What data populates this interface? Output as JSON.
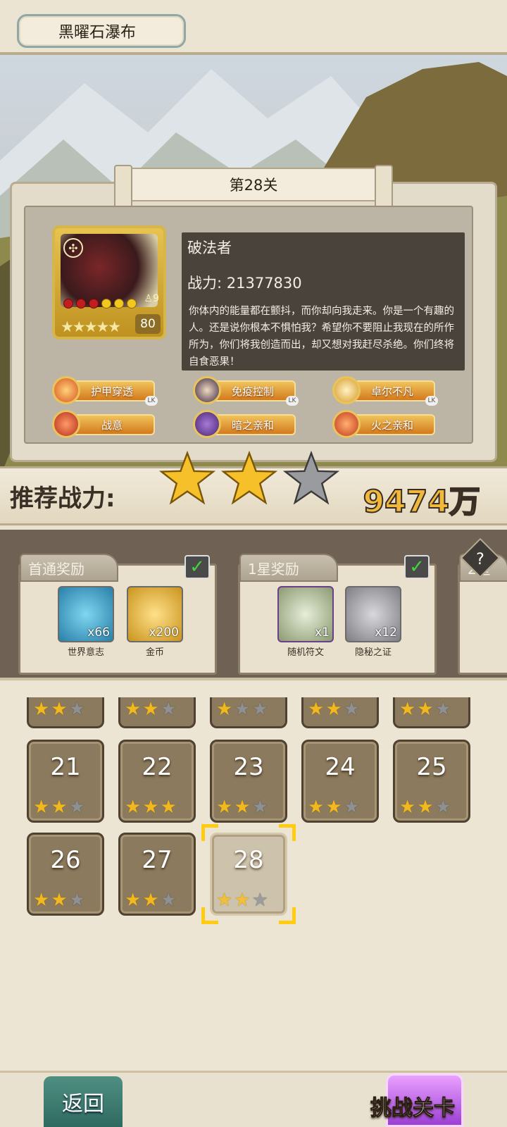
{
  "header": {
    "map_title": "黑曜石瀑布"
  },
  "stage": {
    "banner": "第28关",
    "boss": {
      "name": "破法者",
      "power_label": "战力: 21377830",
      "level": "80",
      "class_count": "9",
      "description": "你体内的能量都在颤抖，而你却向我走来。你是一个有趣的人。还是说你根本不惧怕我？希望你不要阻止我现在的所作所为，你们将我创造而出，却又想对我赶尽杀绝。你们终将自食恶果！"
    },
    "skills": [
      {
        "label": "护甲穿透",
        "icon": "armor-pierce-icon",
        "color": "#d9531f"
      },
      {
        "label": "免疫控制",
        "icon": "control-immune-icon",
        "color": "#3b2a44"
      },
      {
        "label": "卓尔不凡",
        "icon": "excellence-icon",
        "color": "#d79a2b"
      },
      {
        "label": "战意",
        "icon": "battle-will-icon",
        "color": "#b52c1c"
      },
      {
        "label": "暗之亲和",
        "icon": "dark-affinity-icon",
        "color": "#4a2470"
      },
      {
        "label": "火之亲和",
        "icon": "fire-affinity-icon",
        "color": "#c2371a"
      }
    ],
    "earned_stars": 2,
    "max_stars": 3
  },
  "recommend": {
    "label": "推荐战力:",
    "value": "9474万"
  },
  "rewards": [
    {
      "title": "首通奖励",
      "claimed": true,
      "items": [
        {
          "name": "世界意志",
          "count": "x66",
          "icon": "world-will-icon",
          "color": "#2a7fa8"
        },
        {
          "name": "金币",
          "count": "x200",
          "icon": "gold-coin-icon",
          "color": "#c9941d"
        }
      ]
    },
    {
      "title": "1星奖励",
      "claimed": true,
      "items": [
        {
          "name": "随机符文",
          "count": "x1",
          "icon": "random-rune-icon",
          "color": "#a4b08f"
        },
        {
          "name": "隐秘之证",
          "count": "x12",
          "icon": "secret-token-icon",
          "color": "#9a9aa0"
        }
      ]
    },
    {
      "title": "2星",
      "claimed": false,
      "items": []
    }
  ],
  "help_label": "?",
  "levels": {
    "partial_row_stars": [
      2,
      2,
      1,
      2,
      2
    ],
    "tiles": [
      {
        "num": "21",
        "stars": 2
      },
      {
        "num": "22",
        "stars": 3
      },
      {
        "num": "23",
        "stars": 2
      },
      {
        "num": "24",
        "stars": 2
      },
      {
        "num": "25",
        "stars": 2
      },
      {
        "num": "26",
        "stars": 2
      },
      {
        "num": "27",
        "stars": 2
      },
      {
        "num": "28",
        "stars": 2,
        "selected": true
      }
    ]
  },
  "footer": {
    "back_label": "返回",
    "challenge_label": "挑战关卡"
  },
  "colors": {
    "star_gold": "#f2b91e",
    "star_empty": "#8f9092",
    "selection": "#ffcc11",
    "back_button": "#2f6a60"
  }
}
